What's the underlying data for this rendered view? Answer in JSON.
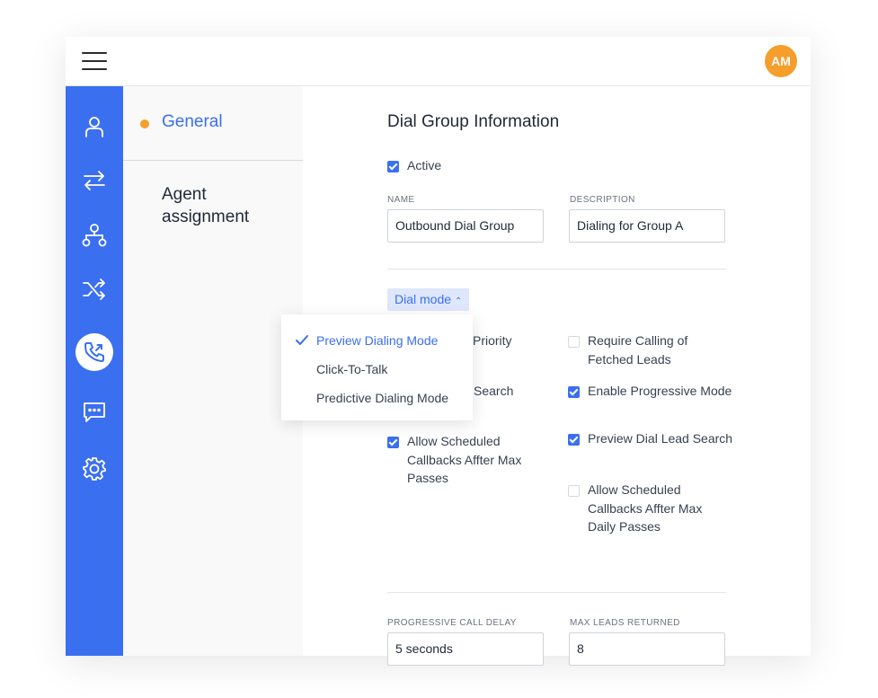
{
  "header": {
    "avatar_initials": "AM"
  },
  "colors": {
    "accent": "#3a6ff0",
    "avatar": "#f59e2b",
    "dialmode_bg": "#dfe7fd"
  },
  "sidebar": {
    "icons": [
      "user-icon",
      "transfer-arrows-icon",
      "hierarchy-icon",
      "shuffle-icon",
      "phone-call-icon",
      "chat-icon",
      "settings-icon"
    ],
    "active": "phone-call-icon"
  },
  "subnav": {
    "general": "General",
    "agent_assignment": "Agent assignment"
  },
  "section": {
    "title": "Dial Group Information"
  },
  "active": {
    "label": "Active",
    "checked": true
  },
  "fields": {
    "name_label": "NAME",
    "name_value": "Outbound Dial Group",
    "description_label": "DESCRIPTION",
    "description_value": "Dialing for Group A"
  },
  "dial_mode": {
    "label": "Dial mode",
    "options": [
      "Preview Dialing Mode",
      "Click-To-Talk",
      "Predictive Dialing Mode"
    ],
    "selected": "Preview Dialing Mode"
  },
  "options": {
    "left": [
      {
        "label": "Priority",
        "checked": null
      },
      {
        "label": "Search",
        "checked": null
      },
      {
        "label": "Allow Scheduled Callbacks Affter Max Passes",
        "checked": true
      }
    ],
    "right": [
      {
        "label": "Require Calling of Fetched Leads",
        "checked": false
      },
      {
        "label": "Enable Progressive Mode",
        "checked": true
      },
      {
        "label": "Preview Dial Lead Search",
        "checked": true
      },
      {
        "label": "Allow Scheduled Callbacks Affter Max Daily Passes",
        "checked": false
      }
    ]
  },
  "bottom": {
    "delay_label": "PROGRESSIVE CALL DELAY",
    "delay_value": "5 seconds",
    "max_leads_label": "MAX LEADS RETURNED",
    "max_leads_value": "8"
  }
}
